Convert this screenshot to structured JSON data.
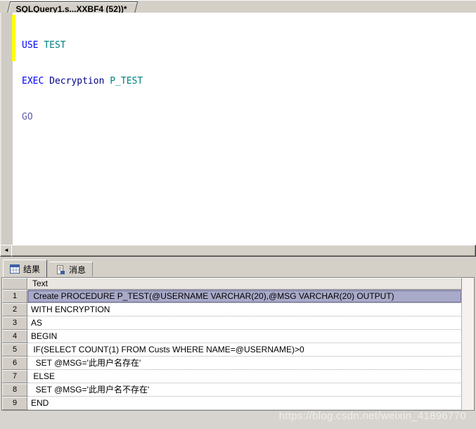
{
  "doc_tab": {
    "title": "SQLQuery1.s...XXBF4 (52))*"
  },
  "editor": {
    "code_lines": [
      {
        "tokens": [
          {
            "t": "USE ",
            "c": "kw"
          },
          {
            "t": "TEST",
            "c": "obj"
          }
        ]
      },
      {
        "tokens": [
          {
            "t": "EXEC ",
            "c": "kw"
          },
          {
            "t": "Decryption ",
            "c": "proc"
          },
          {
            "t": "P_TEST",
            "c": "obj"
          }
        ]
      },
      {
        "tokens": [
          {
            "t": "GO",
            "c": "batch"
          }
        ]
      }
    ]
  },
  "scrollbar": {
    "left_arrow": "◄"
  },
  "results_tabs": [
    {
      "label": "结果",
      "icon": "results-grid-icon",
      "active": true
    },
    {
      "label": "消息",
      "icon": "messages-icon",
      "active": false
    }
  ],
  "grid": {
    "column_header": "Text",
    "rows": [
      {
        "num": "1",
        "text": " Create PROCEDURE P_TEST(@USERNAME VARCHAR(20),@MSG VARCHAR(20) OUTPUT)",
        "selected": true
      },
      {
        "num": "2",
        "text": "WITH ENCRYPTION"
      },
      {
        "num": "3",
        "text": "AS"
      },
      {
        "num": "4",
        "text": "BEGIN"
      },
      {
        "num": "5",
        "text": " IF(SELECT COUNT(1) FROM Custs WHERE NAME=@USERNAME)>0"
      },
      {
        "num": "6",
        "text": "  SET @MSG='此用户名存在'"
      },
      {
        "num": "7",
        "text": " ELSE"
      },
      {
        "num": "8",
        "text": "  SET @MSG='此用户名不存在'"
      },
      {
        "num": "9",
        "text": "END"
      }
    ]
  },
  "watermark": "https://blog.csdn.net/weixin_41896770",
  "colors": {
    "chrome": "#d4d0c8",
    "keyword": "#0000ff",
    "object_name": "#008080",
    "proc_name": "#00008b",
    "batch_separator": "#5a5aae",
    "selection_row_bg": "#a9a9c9",
    "change_bar": "#ffff00"
  }
}
